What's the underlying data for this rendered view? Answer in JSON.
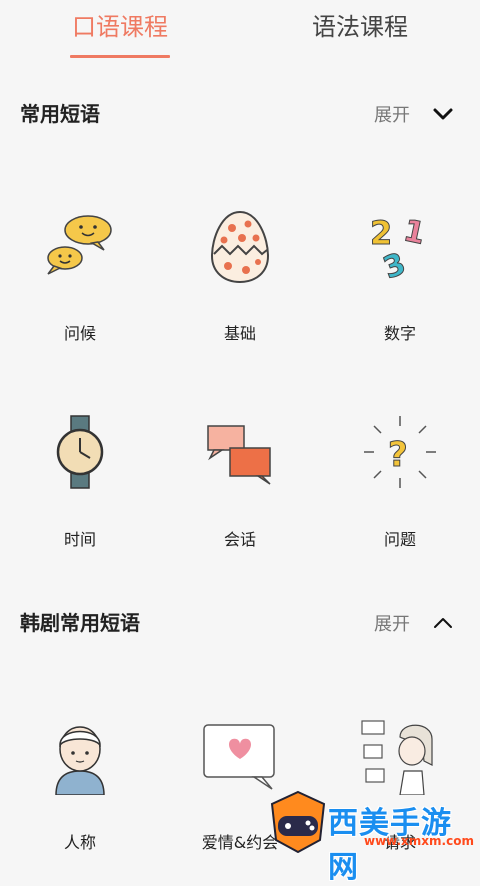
{
  "tabs": [
    {
      "label": "口语课程",
      "active": true
    },
    {
      "label": "语法课程",
      "active": false
    }
  ],
  "colors": {
    "accent": "#ef7a62"
  },
  "sections": [
    {
      "title": "常用短语",
      "expand_label": "展开",
      "chevron": "chevron-down-icon",
      "items": [
        {
          "label": "问候",
          "icon": "chat-bubbles-icon"
        },
        {
          "label": "基础",
          "icon": "egg-icon"
        },
        {
          "label": "数字",
          "icon": "numbers-icon"
        },
        {
          "label": "时间",
          "icon": "watch-icon"
        },
        {
          "label": "会话",
          "icon": "conversation-icon"
        },
        {
          "label": "问题",
          "icon": "question-mark-icon"
        }
      ]
    },
    {
      "title": "韩剧常用短语",
      "expand_label": "展开",
      "chevron": "chevron-up-icon",
      "items": [
        {
          "label": "人称",
          "icon": "person-icon"
        },
        {
          "label": "爱情&约会",
          "icon": "heart-bubble-icon"
        },
        {
          "label": "请求",
          "icon": "girl-chat-icon"
        }
      ]
    }
  ],
  "watermark": {
    "text": "西美手游网",
    "url": "www.xmxm.com"
  }
}
